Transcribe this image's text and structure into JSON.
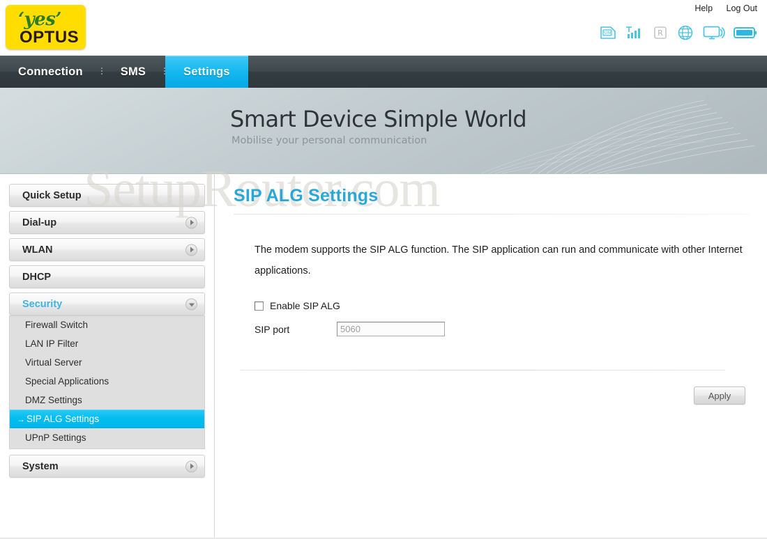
{
  "header": {
    "logo": {
      "yes_text": "‘yes’",
      "brand_text": "OPTUS"
    },
    "links": [
      {
        "label": "Help",
        "name": "help-link"
      },
      {
        "label": "Log Out",
        "name": "logout-link"
      }
    ],
    "status_icons": [
      {
        "name": "sim-card-icon",
        "label": "SIM",
        "state": "active"
      },
      {
        "name": "signal-bars-icon",
        "label": "Signal",
        "state": "active"
      },
      {
        "name": "roaming-icon",
        "label": "R",
        "state": "inactive"
      },
      {
        "name": "globe-network-icon",
        "label": "Network",
        "state": "active"
      },
      {
        "name": "monitor-wifi-icon",
        "label": "WLAN",
        "state": "active"
      },
      {
        "name": "battery-icon",
        "label": "Battery",
        "state": "active"
      }
    ]
  },
  "nav": {
    "items": [
      {
        "label": "Connection",
        "active": false
      },
      {
        "label": "SMS",
        "active": false
      },
      {
        "label": "Settings",
        "active": true
      }
    ]
  },
  "banner": {
    "title": "Smart Device  Simple World",
    "subtitle": "Mobilise your personal communication"
  },
  "watermark": {
    "text": "SetupRouter.com"
  },
  "sidebar": {
    "groups": [
      {
        "label": "Quick Setup",
        "chevron": "none",
        "expanded": false,
        "items": []
      },
      {
        "label": "Dial-up",
        "chevron": "right",
        "expanded": false,
        "items": []
      },
      {
        "label": "WLAN",
        "chevron": "right",
        "expanded": false,
        "items": []
      },
      {
        "label": "DHCP",
        "chevron": "none",
        "expanded": false,
        "items": []
      },
      {
        "label": "Security",
        "chevron": "down",
        "expanded": true,
        "items": [
          {
            "label": "Firewall Switch",
            "selected": false
          },
          {
            "label": "LAN IP Filter",
            "selected": false
          },
          {
            "label": "Virtual Server",
            "selected": false
          },
          {
            "label": "Special Applications",
            "selected": false
          },
          {
            "label": "DMZ Settings",
            "selected": false
          },
          {
            "label": "SIP ALG Settings",
            "selected": true,
            "prefix": "→"
          },
          {
            "label": "UPnP Settings",
            "selected": false
          }
        ]
      },
      {
        "label": "System",
        "chevron": "right",
        "expanded": false,
        "items": []
      }
    ]
  },
  "main": {
    "page_title": "SIP ALG Settings",
    "description": "The modem supports the SIP ALG function. The SIP application can run and communicate with other Internet applications.",
    "checkbox": {
      "label": "Enable SIP ALG",
      "checked": false
    },
    "port_field": {
      "label": "SIP port",
      "value": "5060",
      "placeholder": "5060",
      "disabled": true
    },
    "apply_button": {
      "label": "Apply"
    }
  },
  "colors": {
    "accent_cyan": "#00bdf0",
    "title_blue": "#29a8d8",
    "navbar_dark": "#3f484c",
    "logo_yellow": "#FFDD00",
    "logo_green": "#2f7d1f"
  }
}
